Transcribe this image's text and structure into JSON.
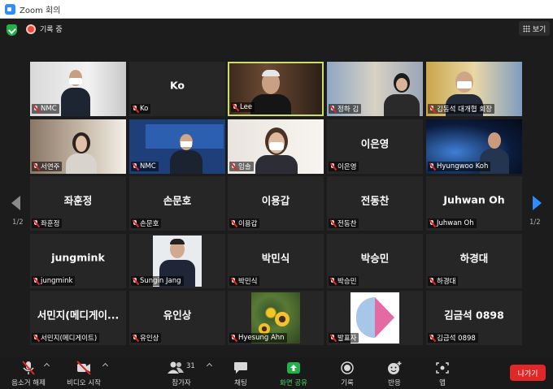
{
  "window": {
    "title": "Zoom 회의"
  },
  "topbar": {
    "recording_label": "기록 중",
    "view_label": "보기"
  },
  "pagination": {
    "left": "1/2",
    "right": "1/2"
  },
  "participants": [
    {
      "id": "p1",
      "name": "NMC",
      "big": "",
      "video": true,
      "active": false
    },
    {
      "id": "p2",
      "name": "Ko",
      "big": "Ko",
      "video": false,
      "active": false
    },
    {
      "id": "p3",
      "name": "Lee",
      "big": "",
      "video": true,
      "active": true
    },
    {
      "id": "p4",
      "name": "정하 김",
      "big": "",
      "video": true,
      "active": false
    },
    {
      "id": "p5",
      "name": "김동석 대개협 회장",
      "big": "",
      "video": true,
      "active": false
    },
    {
      "id": "p6",
      "name": "서연주",
      "big": "",
      "video": true,
      "active": false
    },
    {
      "id": "p7",
      "name": "NMC",
      "big": "",
      "video": true,
      "active": false
    },
    {
      "id": "p8",
      "name": "임솔",
      "big": "",
      "video": true,
      "active": false
    },
    {
      "id": "p9",
      "name": "이은영",
      "big": "이은영",
      "video": false,
      "active": false
    },
    {
      "id": "p10",
      "name": "Hyungwoo Koh",
      "big": "",
      "video": true,
      "active": false
    },
    {
      "id": "p11",
      "name": "좌훈정",
      "big": "좌훈정",
      "video": false,
      "active": false
    },
    {
      "id": "p12",
      "name": "손문호",
      "big": "손문호",
      "video": false,
      "active": false
    },
    {
      "id": "p13",
      "name": "이용갑",
      "big": "이용갑",
      "video": false,
      "active": false
    },
    {
      "id": "p14",
      "name": "전동찬",
      "big": "전동찬",
      "video": false,
      "active": false
    },
    {
      "id": "p15",
      "name": "Juhwan Oh",
      "big": "Juhwan Oh",
      "video": false,
      "active": false
    },
    {
      "id": "p16",
      "name": "jungmink",
      "big": "jungmink",
      "video": false,
      "active": false
    },
    {
      "id": "p17",
      "name": "Sungin Jang",
      "big": "",
      "video": true,
      "active": false
    },
    {
      "id": "p18",
      "name": "박민식",
      "big": "박민식",
      "video": false,
      "active": false
    },
    {
      "id": "p19",
      "name": "박승민",
      "big": "박승민",
      "video": false,
      "active": false
    },
    {
      "id": "p20",
      "name": "하경대",
      "big": "하경대",
      "video": false,
      "active": false
    },
    {
      "id": "p21",
      "name": "서민지(메디게이트)",
      "big": "서민지(메디게이...",
      "video": false,
      "active": false
    },
    {
      "id": "p22",
      "name": "유인상",
      "big": "유인상",
      "video": false,
      "active": false
    },
    {
      "id": "p23",
      "name": "Hyesung Ahn",
      "big": "",
      "video": true,
      "active": false
    },
    {
      "id": "p24",
      "name": "발표자",
      "big": "",
      "video": true,
      "active": false
    },
    {
      "id": "p25",
      "name": "김금석 0898",
      "big": "김금석 0898",
      "video": false,
      "active": false
    }
  ],
  "toolbar": {
    "unmute": "음소거 해제",
    "start_video": "비디오 시작",
    "participants": "참가자",
    "participants_count": "31",
    "chat": "채팅",
    "share_screen": "화면 공유",
    "record": "기록",
    "reactions": "반응",
    "apps": "앱",
    "leave": "나가기"
  }
}
